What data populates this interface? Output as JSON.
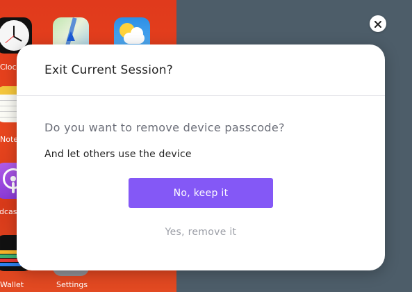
{
  "background": {
    "apps": {
      "clock_label": "Clock",
      "notes_label": "Notes",
      "podcasts_label": "Podcasts",
      "wallet_label": "Wallet",
      "settings_label": "Settings"
    },
    "left_color": "#e0401c",
    "right_color": "#4d5d69"
  },
  "close_icon": "close-icon",
  "dialog": {
    "title": "Exit Current Session?",
    "question": "Do you want to remove device passcode?",
    "subtitle": "And let others use the device",
    "primary_button": "No, keep it",
    "secondary_button": "Yes, remove it",
    "accent_color": "#8458f6"
  }
}
